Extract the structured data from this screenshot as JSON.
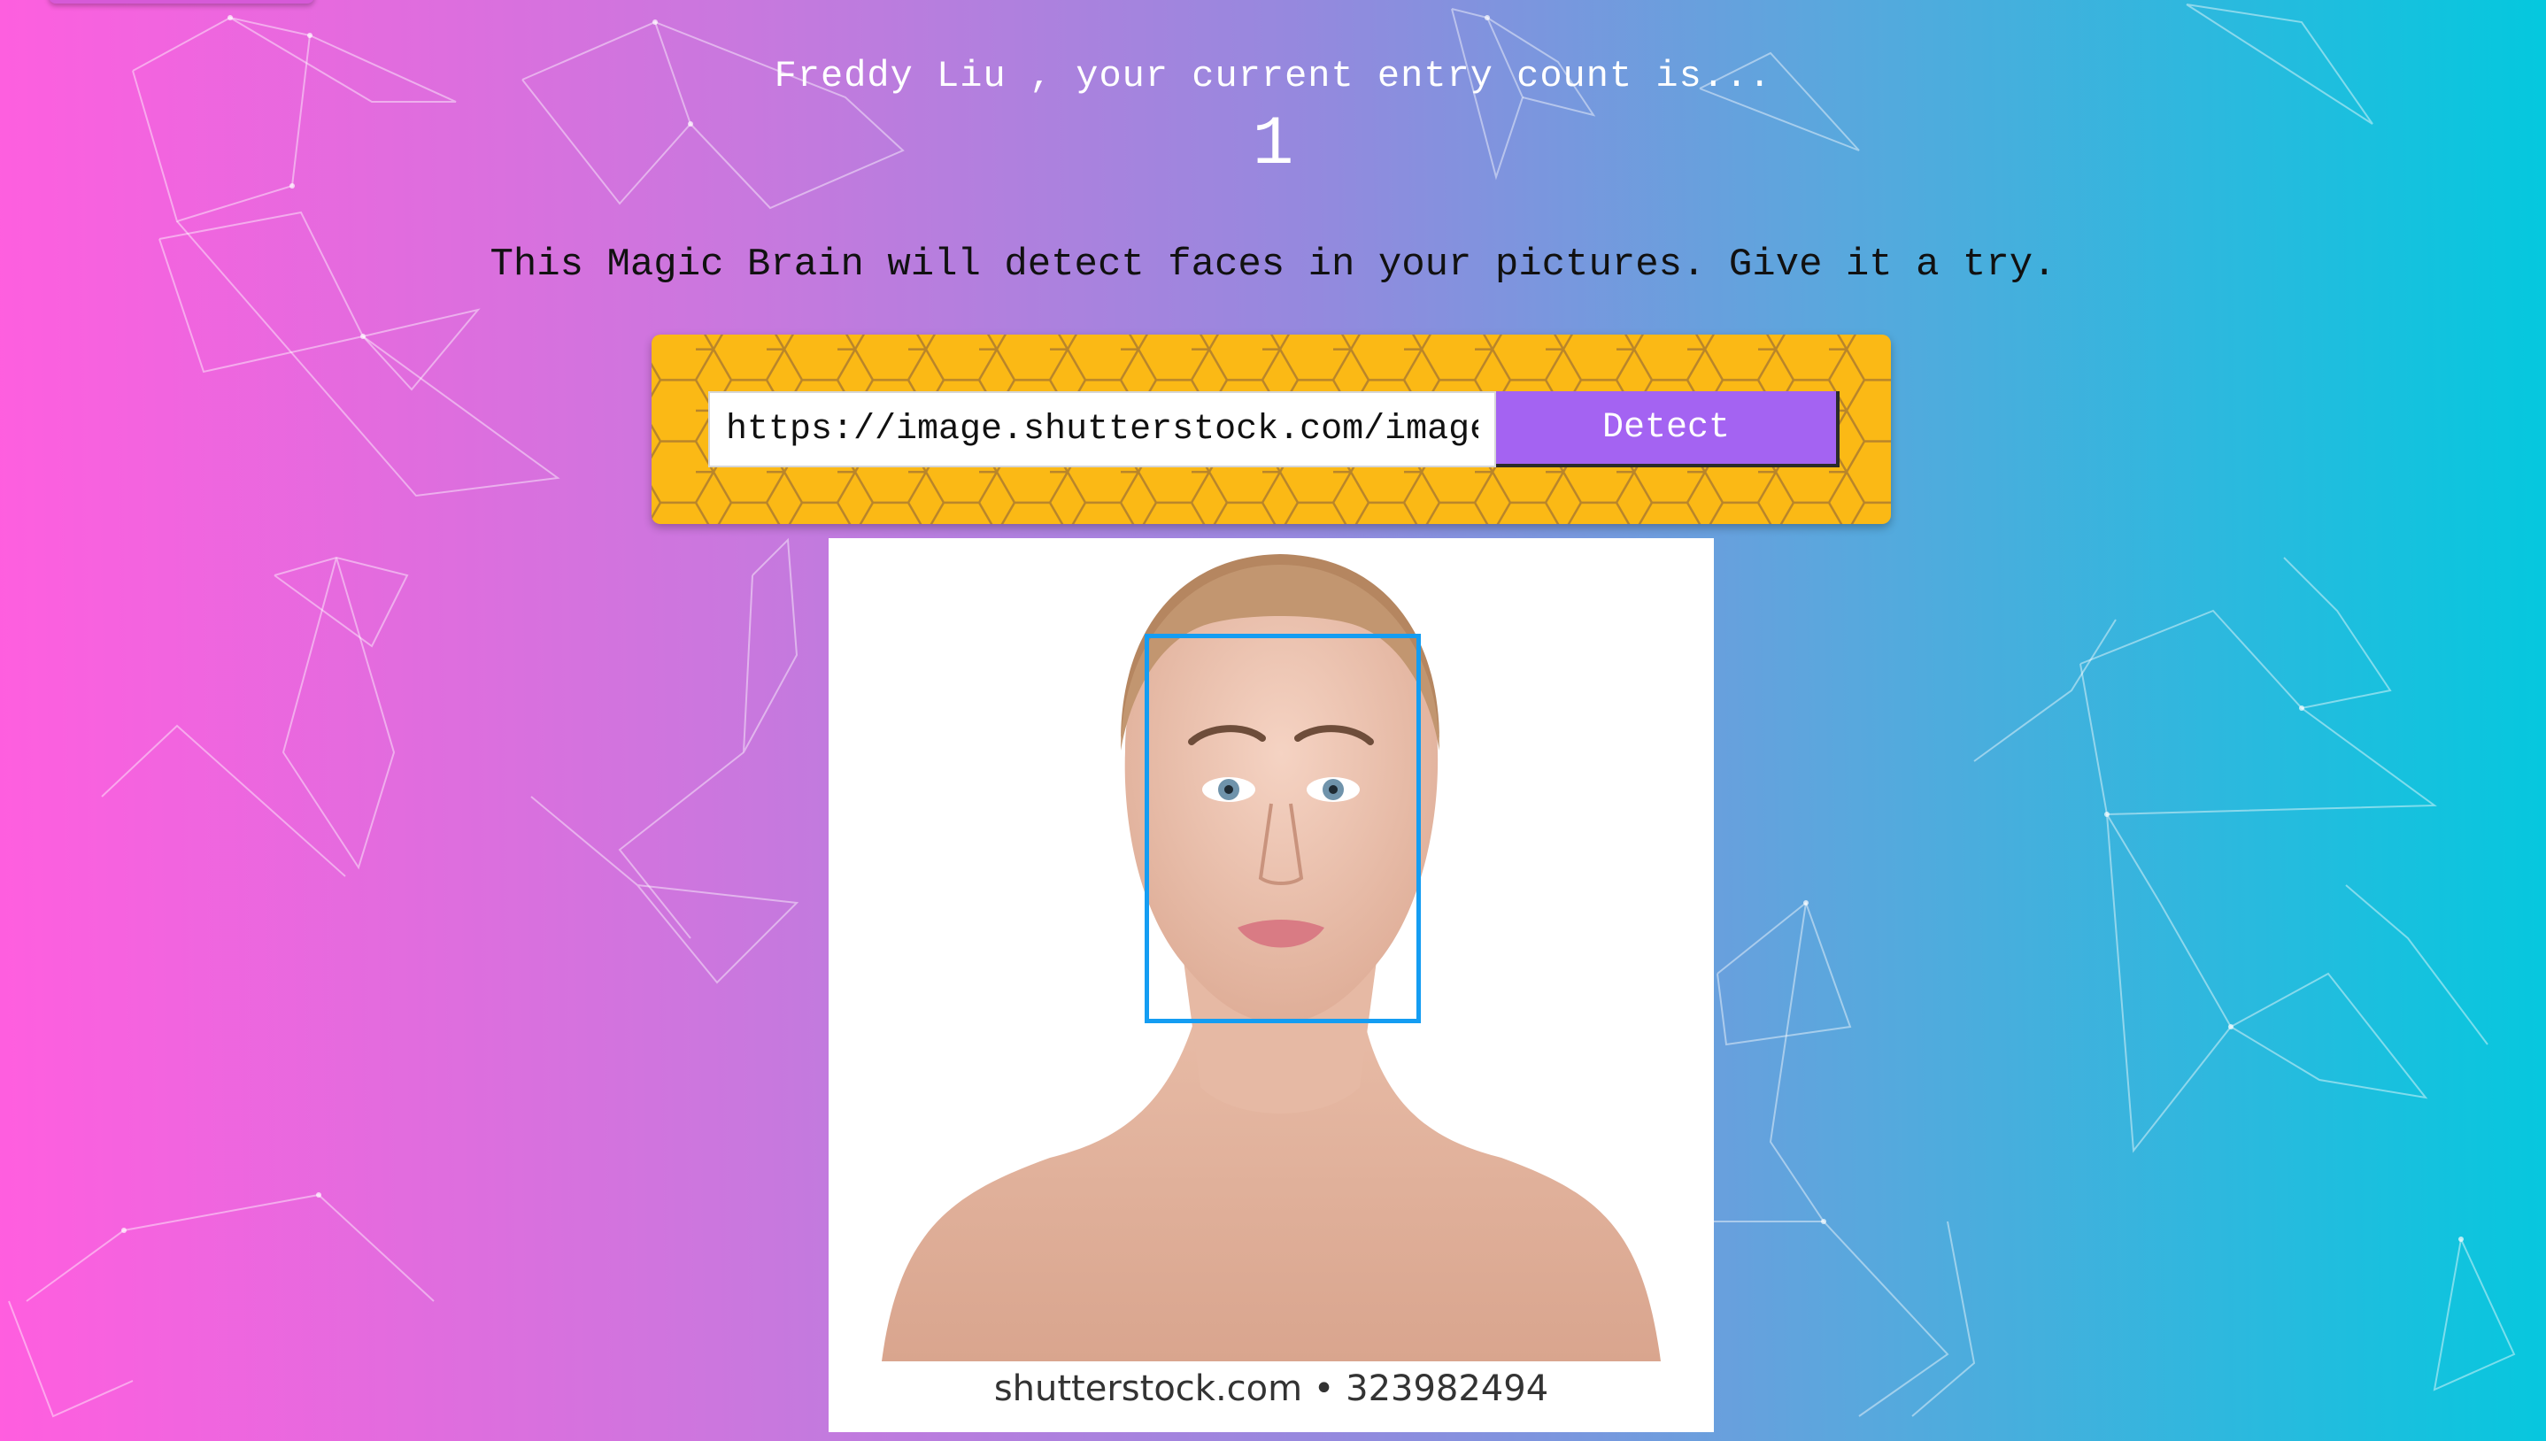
{
  "header": {
    "user_name": "Freddy Liu",
    "greeting_text": "Freddy Liu , your current entry count is...",
    "entry_count": "1"
  },
  "tagline": "This Magic Brain will detect faces in your pictures. Give it a try.",
  "form": {
    "url_value": "https://image.shutterstock.com/image",
    "detect_label": "Detect"
  },
  "image": {
    "caption": "shutterstock.com • 323982494",
    "faces_detected": 1
  },
  "colors": {
    "gradient_start": "#ff5edf",
    "gradient_end": "#04c8de",
    "panel": "#fbb915",
    "button": "#a463f2",
    "face_box": "#149df2"
  }
}
